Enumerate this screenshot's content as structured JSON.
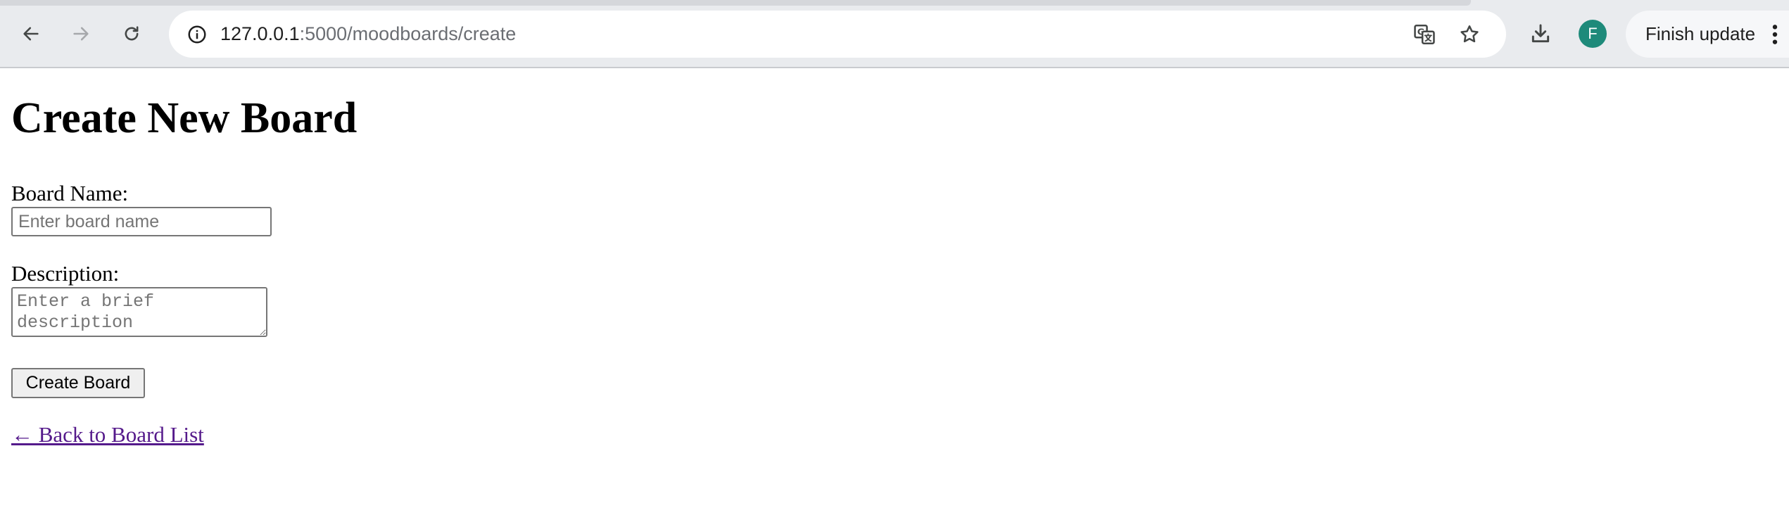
{
  "browser": {
    "url_host": "127.0.0.1",
    "url_path": ":5000/moodboards/create",
    "profile_initial": "F",
    "profile_color": "#1e8a7a",
    "update_label": "Finish update",
    "icons": [
      "back-icon",
      "forward-icon",
      "reload-icon",
      "site-info-icon",
      "translate-icon",
      "bookmark-star-icon",
      "download-icon",
      "more-menu-icon"
    ]
  },
  "page": {
    "title": "Create New Board",
    "form": {
      "name_label": "Board Name:",
      "name_value": "",
      "name_placeholder": "Enter board name",
      "description_label": "Description:",
      "description_value": "",
      "description_placeholder": "Enter a brief description",
      "submit_label": "Create Board"
    },
    "back_link": "← Back to Board List",
    "link_color": "#551a8b"
  }
}
